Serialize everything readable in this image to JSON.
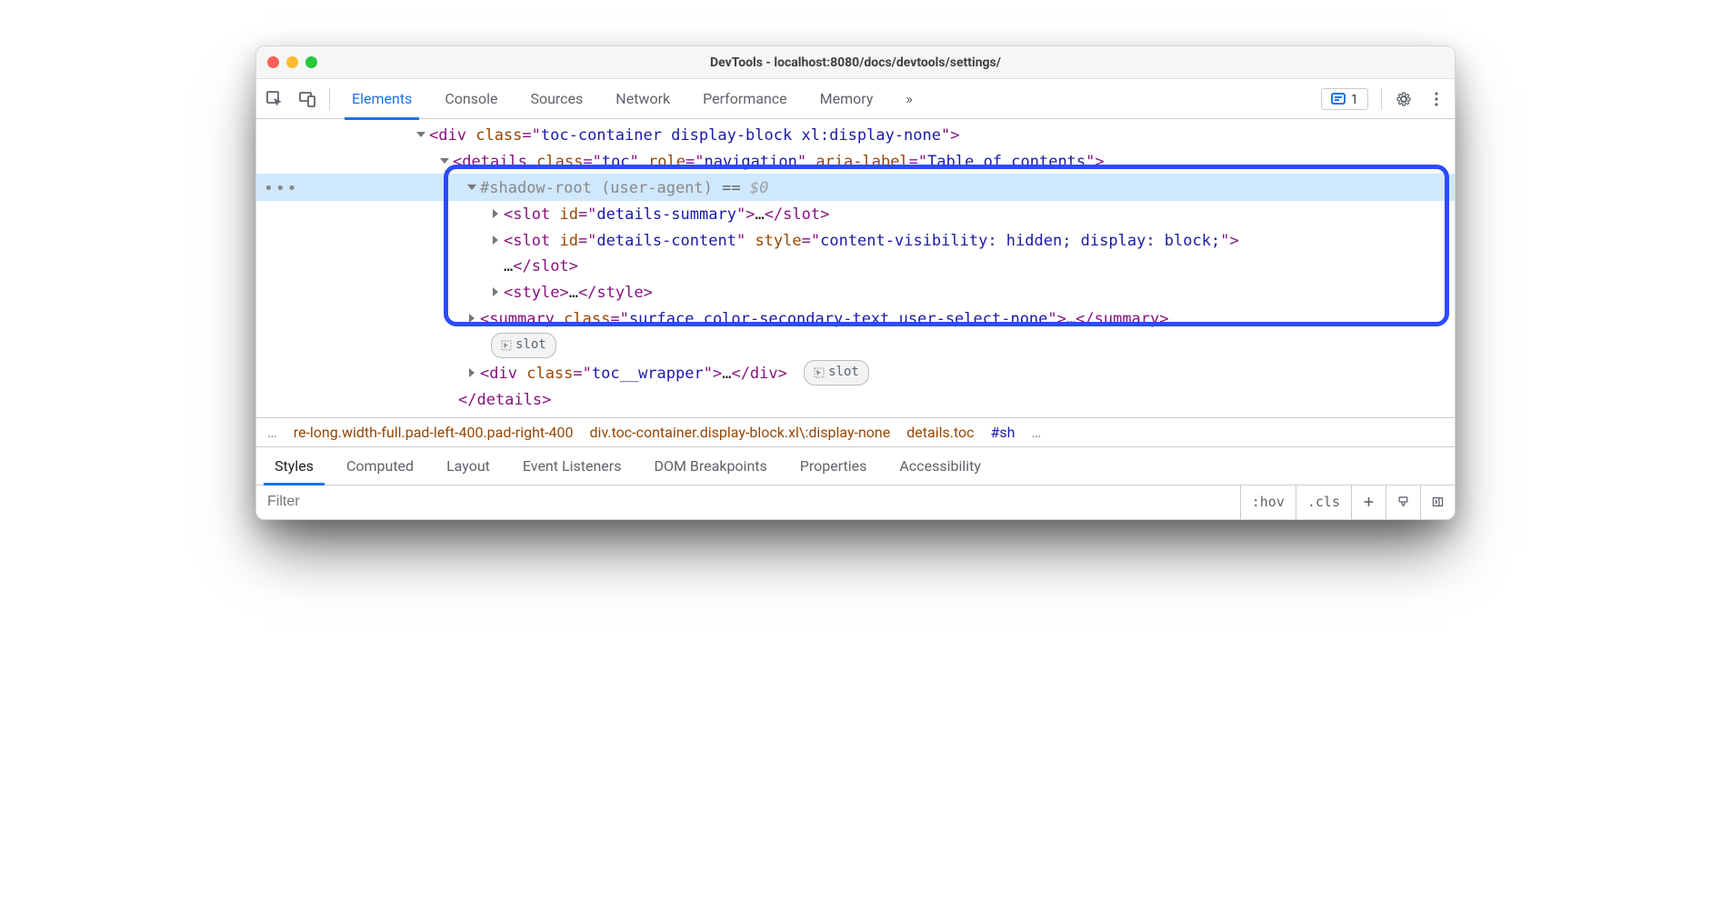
{
  "window": {
    "title": "DevTools - localhost:8080/docs/devtools/settings/"
  },
  "traffic": {
    "close": "close",
    "minimize": "minimize",
    "zoom": "zoom"
  },
  "main_tabs": {
    "items": [
      "Elements",
      "Console",
      "Sources",
      "Network",
      "Performance",
      "Memory"
    ],
    "active": "Elements",
    "more": "»"
  },
  "issues": {
    "count": "1"
  },
  "dom": {
    "gutter": "•••",
    "l0": {
      "open": "<",
      "tag": "div",
      "sp": " ",
      "class_k": "class",
      "eq": "=\"",
      "class_v": "toc-container display-block xl:display-none",
      "close": "\">"
    },
    "l1": {
      "open": "<",
      "tag": "details",
      "sp": " ",
      "class_k": "class",
      "eq": "=\"",
      "class_v": "toc",
      "q": "\" ",
      "role_k": "role",
      "role_v": "navigation",
      "aria_k": "aria-label",
      "aria_v": "Table of contents",
      "close": "\">"
    },
    "l2": {
      "hash": "#",
      "shadow": "shadow-root (user-agent)",
      "eq": " == ",
      "dollar": "$0"
    },
    "l3a": {
      "open": "<",
      "tag": "slot",
      "sp": " ",
      "id_k": "id",
      "eq": "=\"",
      "id_v": "details-summary",
      "close": "\">",
      "ell": "…",
      "ctag": "</slot>"
    },
    "l3b": {
      "open": "<",
      "tag": "slot",
      "sp": " ",
      "id_k": "id",
      "eq": "=\"",
      "id_v": "details-content",
      "q": "\" ",
      "style_k": "style",
      "style_v": "content-visibility: hidden; display: block;",
      "close": "\">"
    },
    "l3b2": {
      "ell": "…",
      "ctag": "</slot>"
    },
    "l3c": {
      "open": "<",
      "tag": "style",
      "close": ">",
      "ell": "…",
      "ctag": "</style>"
    },
    "l4": {
      "open": "<",
      "tag": "summary",
      "sp": " ",
      "class_k": "class",
      "eq": "=\"",
      "class_v": "surface color-secondary-text user-select-none",
      "close": "\">",
      "ell": "…",
      "ctag": "</summary>"
    },
    "slot_pill": "slot",
    "l5": {
      "open": "<",
      "tag": "div",
      "sp": " ",
      "class_k": "class",
      "eq": "=\"",
      "class_v": "toc__wrapper",
      "close": "\">",
      "ell": "…",
      "ctag": "</div>"
    },
    "l6": {
      "ctag": "</details>"
    }
  },
  "crumbs": {
    "ell_left": "…",
    "c0": "re-long.width-full.pad-left-400.pad-right-400",
    "c1": "div.toc-container.display-block.xl\\:display-none",
    "c2": "details.toc",
    "c3": "#sh",
    "ell_right": "…"
  },
  "styles_tabs": {
    "items": [
      "Styles",
      "Computed",
      "Layout",
      "Event Listeners",
      "DOM Breakpoints",
      "Properties",
      "Accessibility"
    ],
    "active": "Styles"
  },
  "filter": {
    "placeholder": "Filter",
    "hov": ":hov",
    "cls": ".cls"
  }
}
